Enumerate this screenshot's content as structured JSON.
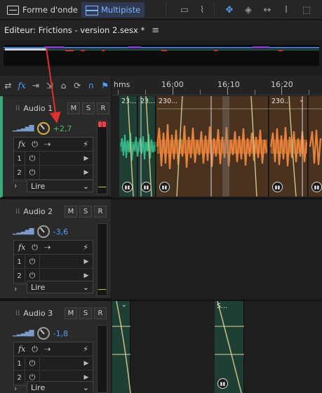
{
  "toolbar": {
    "waveform_label": "Forme d'onde",
    "multitrack_label": "Multipiste"
  },
  "editor": {
    "title": "Editeur: Frictions - version 2.sesx *"
  },
  "ruler": {
    "labels": [
      "hms",
      "16:00",
      "16:10",
      "16:20"
    ]
  },
  "tracks": [
    {
      "name": "Audio 1",
      "volume": "+2,7",
      "volume_color": "#4fbf6a",
      "read_mode": "Lire",
      "fx_rows": [
        "1",
        "2"
      ],
      "mute": "M",
      "solo": "S",
      "record": "R"
    },
    {
      "name": "Audio 2",
      "volume": "-3,6",
      "volume_color": "#4fa0ff",
      "read_mode": "Lire",
      "fx_rows": [
        "1",
        "2"
      ],
      "mute": "M",
      "solo": "S",
      "record": "R"
    },
    {
      "name": "Audio 3",
      "volume": "-1,8",
      "volume_color": "#4fa0ff",
      "read_mode": "Lire",
      "fx_rows": [
        "1",
        "2"
      ],
      "mute": "M",
      "solo": "S",
      "record": "R"
    }
  ],
  "clips": {
    "track1": [
      "23...",
      "23...",
      "230...",
      "230..."
    ],
    "track3": [
      "S..."
    ]
  },
  "colors": {
    "accent": "#4fa0ff",
    "selected_track": "#3aa87a",
    "clip_green": "#35b785",
    "clip_orange": "#e8823a",
    "annotation_arrow": "#e03030"
  }
}
